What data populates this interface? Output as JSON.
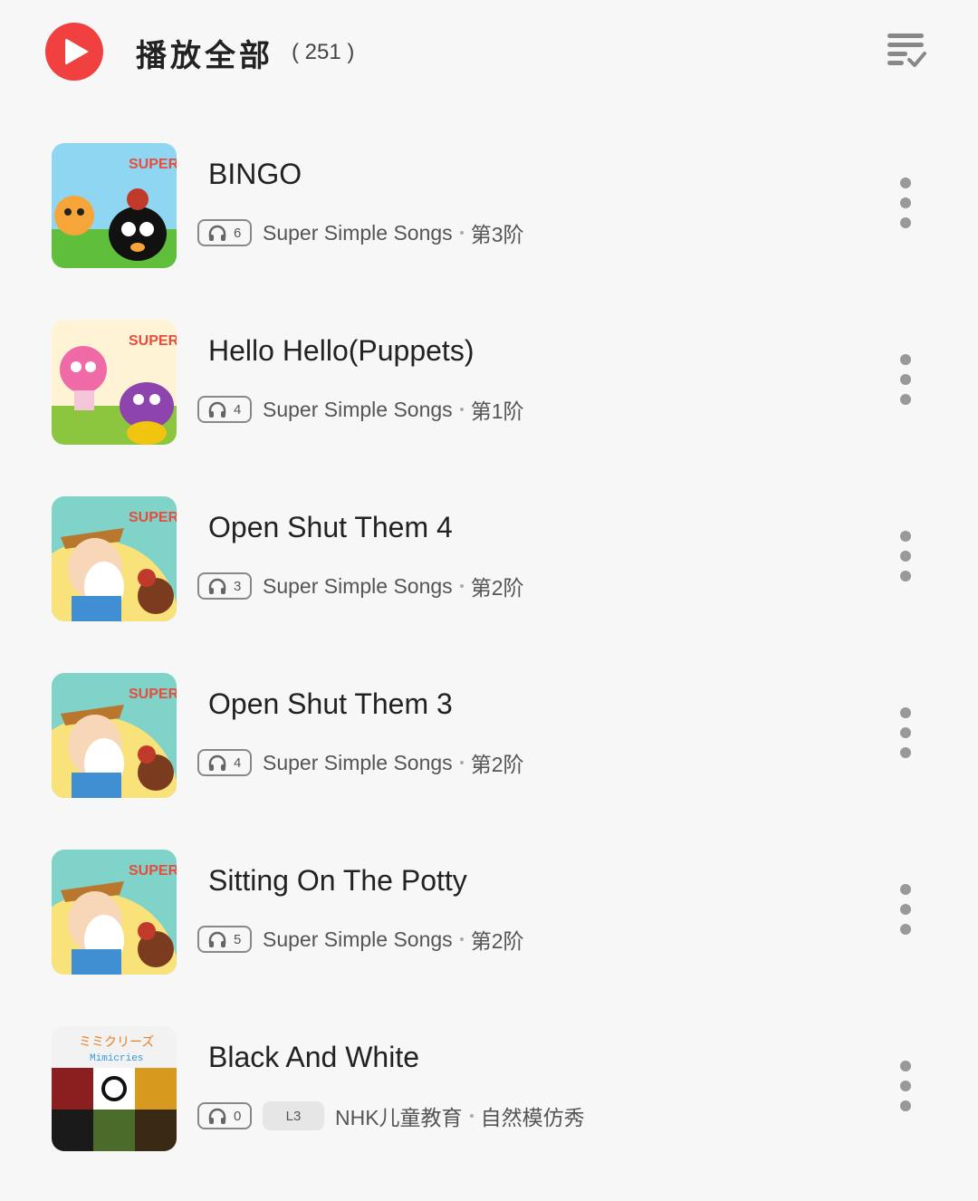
{
  "header": {
    "title": "播放全部",
    "count": "( 251 )"
  },
  "items": [
    {
      "title": "BINGO",
      "plays": "6",
      "level": "",
      "source": "Super Simple Songs",
      "stage": "第3阶",
      "cover": "super-simple-songs-bingo"
    },
    {
      "title": "Hello Hello(Puppets)",
      "plays": "4",
      "level": "",
      "source": "Super Simple Songs",
      "stage": "第1阶",
      "cover": "super-simple-songs-puppets"
    },
    {
      "title": "Open Shut Them 4",
      "plays": "3",
      "level": "",
      "source": "Super Simple Songs",
      "stage": "第2阶",
      "cover": "super-simple-songs-farmer"
    },
    {
      "title": "Open Shut Them 3",
      "plays": "4",
      "level": "",
      "source": "Super Simple Songs",
      "stage": "第2阶",
      "cover": "super-simple-songs-farmer"
    },
    {
      "title": "Sitting On The Potty",
      "plays": "5",
      "level": "",
      "source": "Super Simple Songs",
      "stage": "第2阶",
      "cover": "super-simple-songs-farmer"
    },
    {
      "title": "Black And White",
      "plays": "0",
      "level": "L3",
      "source": "NHK儿童教育",
      "stage": "自然模仿秀",
      "cover": "nhk-mimicries"
    }
  ],
  "colors": {
    "accent": "#f04040",
    "background": "#f7f7f7"
  }
}
